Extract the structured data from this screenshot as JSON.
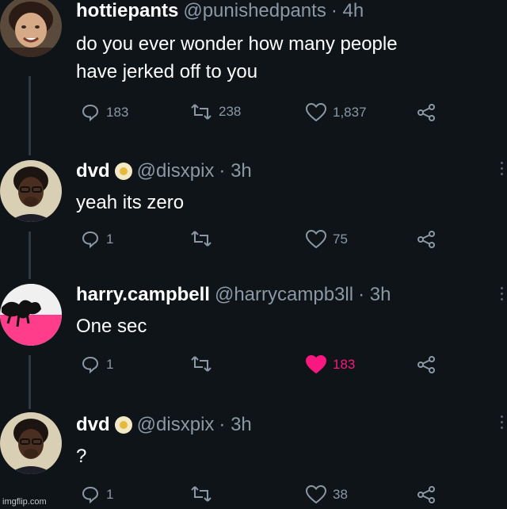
{
  "tweets": [
    {
      "name": "hottiepants",
      "handle": "@punishedpants",
      "time": "· 4h",
      "verified": false,
      "text_lines": [
        "do you ever wonder how many people",
        "have jerked off to you"
      ],
      "replies": "183",
      "retweets": "238",
      "likes": "1,837",
      "liked": false
    },
    {
      "name": "dvd",
      "handle": "@disxpix",
      "time": "· 3h",
      "verified": true,
      "text_lines": [
        "yeah its zero"
      ],
      "replies": "1",
      "retweets": "",
      "likes": "75",
      "liked": false
    },
    {
      "name": "harry.campbell",
      "handle": "@harrycampb3ll",
      "time": "· 3h",
      "verified": false,
      "text_lines": [
        "One sec"
      ],
      "replies": "1",
      "retweets": "",
      "likes": "183",
      "liked": true
    },
    {
      "name": "dvd",
      "handle": "@disxpix",
      "time": "· 3h",
      "verified": true,
      "text_lines": [
        "?"
      ],
      "replies": "1",
      "retweets": "",
      "likes": "38",
      "liked": false
    }
  ],
  "watermark": "imgflip.com",
  "colors": {
    "background": "#0f1419",
    "secondary_text": "#8b98a5",
    "like_active": "#f91880"
  },
  "icons": [
    "reply-icon",
    "retweet-icon",
    "like-icon",
    "share-icon",
    "more-options-icon",
    "verified-badge-icon"
  ]
}
